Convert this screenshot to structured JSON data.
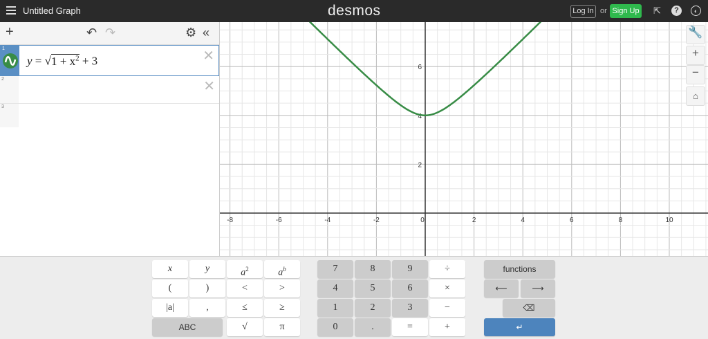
{
  "header": {
    "title": "Untitled Graph",
    "logo": "desmos",
    "login": "Log In",
    "or": "or",
    "signup": "Sign Up",
    "icons": [
      "share-icon",
      "help-icon",
      "globe-icon"
    ],
    "help_glyph": "?"
  },
  "expressions": [
    {
      "index": "1",
      "latex": "y = √(1 + x²) + 3",
      "color": "#388c46"
    },
    {
      "index": "2"
    },
    {
      "index": "3"
    }
  ],
  "expr_parts": {
    "lhs": "y",
    "eq": "=",
    "sqrt": "√",
    "inner": "1 + x",
    "exp": "2",
    "tail": "+ 3"
  },
  "graph": {
    "x_ticks": [
      "-8",
      "-6",
      "-4",
      "-2",
      "0",
      "2",
      "4",
      "6",
      "8",
      "10"
    ],
    "y_ticks": [
      "2",
      "4",
      "6"
    ],
    "curve_color": "#388c46",
    "accent": "#2fb94d"
  },
  "keypad": {
    "left": [
      [
        "x",
        "y",
        "a2",
        "ab"
      ],
      [
        "(",
        ")",
        "<",
        ">"
      ],
      [
        "|a|",
        ",",
        "≤",
        "≥"
      ],
      [
        "ABC",
        "√",
        "π"
      ]
    ],
    "middle": [
      [
        "7",
        "8",
        "9",
        "÷"
      ],
      [
        "4",
        "5",
        "6",
        "×"
      ],
      [
        "1",
        "2",
        "3",
        "−"
      ],
      [
        "0",
        ".",
        "=",
        "+"
      ]
    ],
    "functions": "functions",
    "left_arrow": "⟵",
    "right_arrow": "⟶",
    "backspace": "⌫",
    "enter": "↵"
  }
}
